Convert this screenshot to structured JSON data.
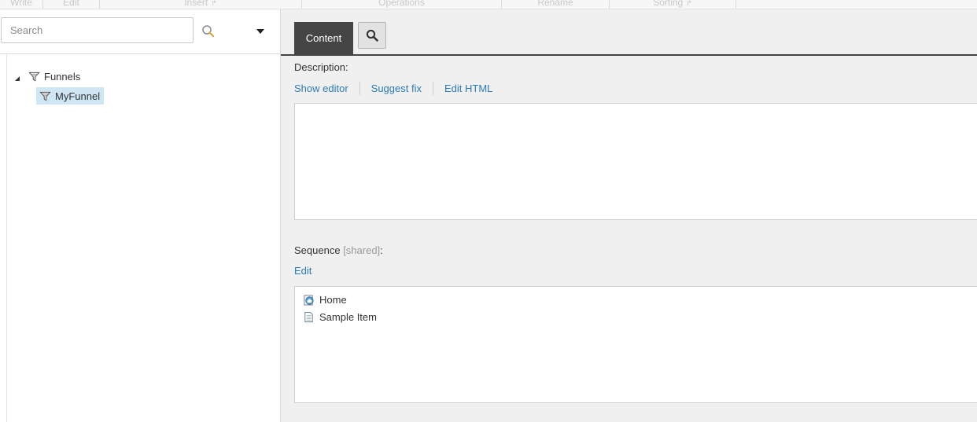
{
  "ribbon": {
    "groups": [
      "Write",
      "Edit",
      "Insert",
      "Operations",
      "Rename",
      "Sorting"
    ]
  },
  "search": {
    "placeholder": "Search"
  },
  "tree": {
    "root_label": "Funnels",
    "child_label": "MyFunnel"
  },
  "tabs": {
    "content_label": "Content"
  },
  "description": {
    "label": "Description:",
    "links": [
      "Show editor",
      "Suggest fix",
      "Edit HTML"
    ]
  },
  "sequence": {
    "label": "Sequence",
    "shared_note": "[shared]",
    "colon": ":",
    "edit_link": "Edit",
    "items": [
      "Home",
      "Sample Item"
    ]
  },
  "colors": {
    "link": "#2b7bb9",
    "tab_active_bg": "#454545",
    "selection_bg": "#cfe6f5",
    "pane_bg": "#f0f0f0"
  },
  "icons": {
    "search": "magnifier-icon",
    "dropdown": "caret-down-icon",
    "tree_toggle": "triangle-expanded-icon",
    "funnel": "funnel-icon",
    "home": "home-page-icon",
    "document": "document-icon"
  }
}
